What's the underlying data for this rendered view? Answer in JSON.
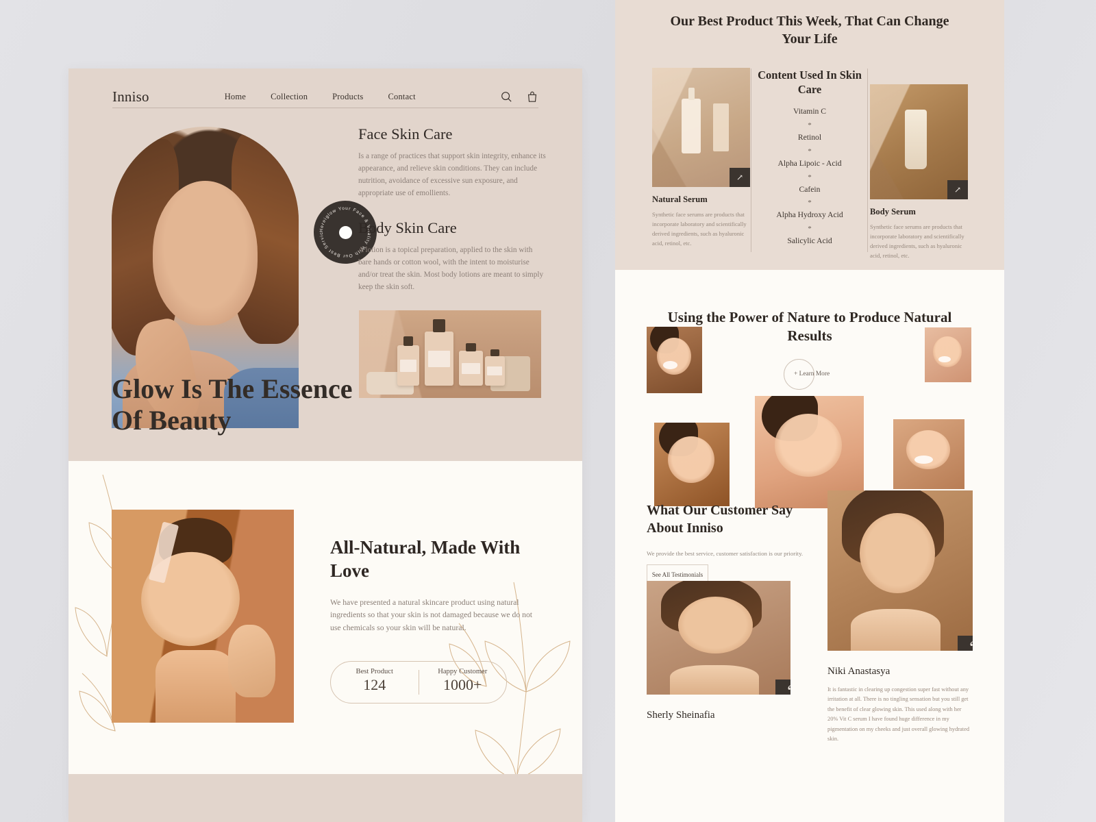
{
  "left": {
    "brand": "Inniso",
    "nav": [
      {
        "label": "Home"
      },
      {
        "label": "Collection"
      },
      {
        "label": "Products"
      },
      {
        "label": "Contact"
      }
    ],
    "icons": {
      "search": "search-icon",
      "bag": "shopping-bag-icon"
    },
    "badge_text": "Hereiglow Your Face & Vitality With Our Best Service ",
    "sections": [
      {
        "heading": "Face Skin Care",
        "body": "Is a range of practices that support skin integrity, enhance its appearance, and relieve skin conditions. They can include nutrition, avoidance of excessive sun exposure, and appropriate use of emollients."
      },
      {
        "heading": "Body Skin Care",
        "body": "A lotion is a topical preparation, applied to the skin with bare hands or cotton wool, with the intent to moisturise and/or treat the skin. Most body lotions are meant to simply keep the skin soft."
      }
    ],
    "hero_title": "Glow Is The Essence Of Beauty",
    "natural": {
      "heading": "All-Natural, Made With Love",
      "body": "We have presented a natural skincare product using natural ingredients so that your skin is not damaged because we do not use chemicals so your skin will be natural.",
      "stats": [
        {
          "label": "Best Product",
          "value": "124"
        },
        {
          "label": "Happy Customer",
          "value": "1000+"
        }
      ]
    }
  },
  "right": {
    "best_product_title": "Our Best Product This Week, That Can Change Your Life",
    "products": [
      {
        "name": "Natural Serum",
        "desc": "Synthetic face serums are products that incorporate laboratory and scientifically derived ingredients, such as hyaluronic acid, retinol, etc.",
        "arrow": "↗"
      },
      {
        "name": "Body Serum",
        "desc": "Synthetic face serums are products that incorporate laboratory and scientifically derived ingredients, such as hyaluronic acid, retinol, etc.",
        "arrow": "↗"
      }
    ],
    "ingredients": {
      "heading": "Content Used In Skin Care",
      "separator": "*",
      "items": [
        "Vitamin C",
        "Retinol",
        "Alpha Lipoic - Acid",
        "Cafein",
        "Alpha Hydroxy Acid",
        "Salicylic Acid"
      ]
    },
    "nature": {
      "heading": "Using the Power of Nature to Produce Natural Results",
      "learn_more": "+ Learn More"
    },
    "testimonials": {
      "heading": "What Our Customer Say About Inniso",
      "subtext": "We provide the best service, customer satisfaction is our priority.",
      "button": "See All Testimonials",
      "quote_glyph": "“",
      "items": [
        {
          "name": "Sherly Sheinafia",
          "text": ""
        },
        {
          "name": "Niki Anastasya",
          "text": "It is fantastic in clearing up congestion super fast without any irritation at all. There is no tingling sensation but you still get the benefit of clear glowing skin. This used along with her 20% Vit C serum I have found huge difference in my pigmentation on my cheeks and just overall glowing hydrated skin."
        }
      ]
    }
  },
  "colors": {
    "hero_bg": "#e2d5cc",
    "cream_bg": "#fdfbf6",
    "right_top_bg": "#e8dcd3",
    "dark": "#3b342f",
    "text": "#2e2722",
    "muted": "#8d8079",
    "gold": "#cfa87a"
  }
}
